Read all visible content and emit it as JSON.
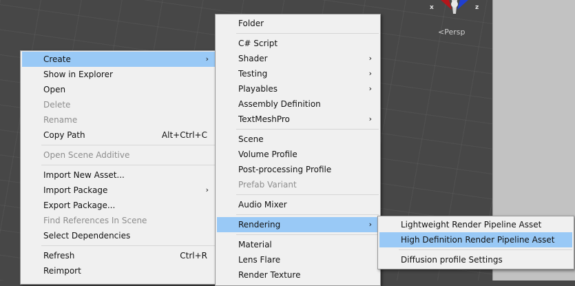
{
  "scene": {
    "persp_label": "Persp",
    "gizmo_axes": {
      "x": "x",
      "z": "z"
    }
  },
  "context_menu": {
    "items": [
      {
        "label": "Create",
        "highlighted": true,
        "submenu": true
      },
      {
        "label": "Show in Explorer"
      },
      {
        "label": "Open"
      },
      {
        "label": "Delete",
        "disabled": true
      },
      {
        "label": "Rename",
        "disabled": true
      },
      {
        "label": "Copy Path",
        "shortcut": "Alt+Ctrl+C"
      },
      {
        "label": "Open Scene Additive",
        "disabled": true
      },
      {
        "label": "Import New Asset..."
      },
      {
        "label": "Import Package",
        "submenu": true
      },
      {
        "label": "Export Package..."
      },
      {
        "label": "Find References In Scene",
        "disabled": true
      },
      {
        "label": "Select Dependencies"
      },
      {
        "label": "Refresh",
        "shortcut": "Ctrl+R"
      },
      {
        "label": "Reimport"
      }
    ]
  },
  "create_menu": {
    "items": [
      {
        "label": "Folder"
      },
      {
        "label": "C# Script"
      },
      {
        "label": "Shader",
        "submenu": true
      },
      {
        "label": "Testing",
        "submenu": true
      },
      {
        "label": "Playables",
        "submenu": true
      },
      {
        "label": "Assembly Definition"
      },
      {
        "label": "TextMeshPro",
        "submenu": true
      },
      {
        "label": "Scene"
      },
      {
        "label": "Volume Profile"
      },
      {
        "label": "Post-processing Profile"
      },
      {
        "label": "Prefab Variant",
        "disabled": true
      },
      {
        "label": "Audio Mixer"
      },
      {
        "label": "Rendering",
        "highlighted": true,
        "submenu": true
      },
      {
        "label": "Material"
      },
      {
        "label": "Lens Flare"
      },
      {
        "label": "Render Texture"
      }
    ]
  },
  "rendering_menu": {
    "items": [
      {
        "label": "Lightweight Render Pipeline Asset"
      },
      {
        "label": "High Definition Render Pipeline Asset",
        "highlighted": true
      },
      {
        "label": "Diffusion profile Settings"
      }
    ]
  },
  "icons": {
    "submenu_arrow": "›"
  },
  "colors": {
    "highlight": "#99c9f6",
    "menu_bg": "#f0f0f0",
    "disabled_text": "#8d8d8d",
    "scene_bg": "#474747"
  }
}
